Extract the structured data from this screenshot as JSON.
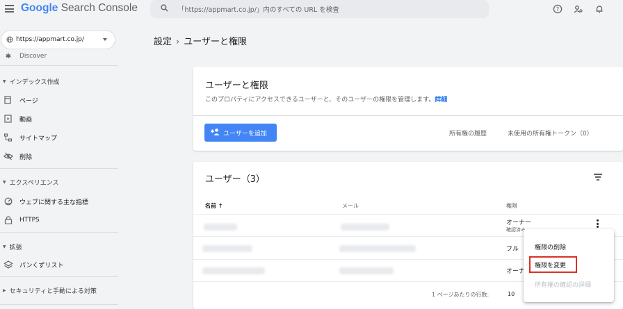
{
  "header": {
    "logo_google": "Google",
    "logo_product": "Search Console",
    "search_placeholder": "「https://appmart.co.jp/」内のすべての URL を検査",
    "icons": [
      "menu-icon",
      "search-icon",
      "help-icon",
      "account-icon",
      "bell-icon"
    ]
  },
  "sidebar": {
    "property": "https://appmart.co.jp/",
    "items": {
      "discover": "Discover",
      "index_section": "インデックス作成",
      "pages": "ページ",
      "videos": "動画",
      "sitemaps": "サイトマップ",
      "removals": "削除",
      "experience_section": "エクスペリエンス",
      "web_vitals": "ウェブに関する主な指標",
      "https": "HTTPS",
      "enhancements_section": "拡張",
      "breadcrumbs": "パンくずリスト",
      "security_section": "セキュリティと手動による対策"
    }
  },
  "breadcrumb": {
    "parent": "設定",
    "separator": "›",
    "current": "ユーザーと権限"
  },
  "permissions_card": {
    "title": "ユーザーと権限",
    "description": "このプロパティにアクセスできるユーザーと、そのユーザーの権限を管理します。",
    "details_link": "詳細",
    "add_user_button": "ユーザーを追加",
    "ownership_history": "所有権の履歴",
    "unused_tokens": "未使用の所有権トークン（0）"
  },
  "users_card": {
    "title": "ユーザー（3）",
    "columns": {
      "name": "名前 ↑",
      "email": "メール",
      "permission": "権限"
    },
    "rows": [
      {
        "permission": "オーナー",
        "sub": "確認済み"
      },
      {
        "permission": "フル",
        "sub": ""
      },
      {
        "permission": "オーナ",
        "sub": ""
      }
    ],
    "rows_per_page_label": "1 ページあたりの行数:",
    "rows_per_page_value": "10"
  },
  "context_menu": {
    "remove_access": "権限の削除",
    "change_permission": "権限を変更",
    "ownership_details": "所有権の確認の詳細"
  },
  "colors": {
    "accent": "#4285f4",
    "link": "#1a73e8",
    "highlight": "#d93025",
    "background": "#f1f3f4"
  }
}
